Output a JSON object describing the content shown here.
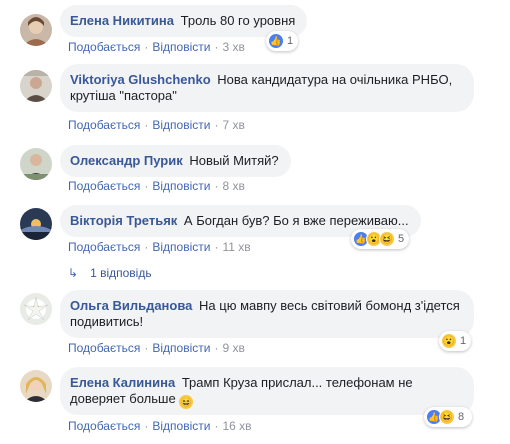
{
  "comments": [
    {
      "author": "Елена Никитина",
      "text": "Троль 80 го уровня",
      "like_label": "Подобається",
      "reply_label": "Відповісти",
      "time": "3 хв",
      "reaction_count": "1"
    },
    {
      "author": "Viktoriya Glushchenko",
      "text": "Нова кандидатура на очільника РНБО, крутіша \"пастора\"",
      "like_label": "Подобається",
      "reply_label": "Відповісти",
      "time": "7 хв"
    },
    {
      "author": "Олександр Пурик",
      "text": "Новый Митяй?",
      "like_label": "Подобається",
      "reply_label": "Відповісти",
      "time": "8 хв"
    },
    {
      "author": "Вікторія Третьяк",
      "text": "А Богдан був? Бо я вже переживаю...",
      "like_label": "Подобається",
      "reply_label": "Відповісти",
      "time": "11 хв",
      "reaction_count": "5",
      "replies_label": "1 відповідь"
    },
    {
      "author": "Ольга Вильданова",
      "text": "На цю мавпу весь світовий бомонд з'ідется подивитись!",
      "like_label": "Подобається",
      "reply_label": "Відповісти",
      "time": "9 хв",
      "reaction_count": "1"
    },
    {
      "author": "Елена Калинина",
      "text": "Трамп Круза прислал... телефонам не доверяет больше",
      "like_label": "Подобається",
      "reply_label": "Відповісти",
      "time": "16 хв",
      "reaction_count": "8"
    }
  ],
  "colors": {
    "link": "#385898",
    "bubble": "#f2f3f5",
    "meta": "#90949c"
  },
  "icons": {
    "like": "like-icon",
    "wow": "wow-icon",
    "haha": "haha-icon",
    "reply_arrow": "reply-arrow-icon"
  }
}
